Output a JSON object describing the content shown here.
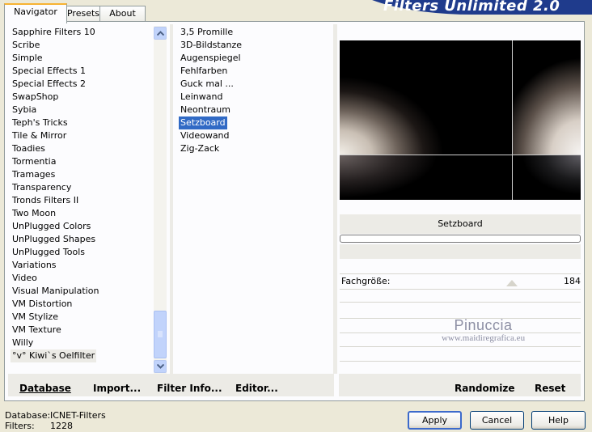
{
  "app_title": "Filters Unlimited 2.0",
  "tabs": [
    {
      "label": "Navigator",
      "active": true
    },
    {
      "label": "Presets",
      "active": false
    },
    {
      "label": "About",
      "active": false
    }
  ],
  "categories": [
    "Sapphire Filters 10",
    "Scribe",
    "Simple",
    "Special Effects 1",
    "Special Effects 2",
    "SwapShop",
    "Sybia",
    "Teph's Tricks",
    "Tile & Mirror",
    "Toadies",
    "Tormentia",
    "Tramages",
    "Transparency",
    "Tronds Filters II",
    "Two Moon",
    "UnPlugged Colors",
    "UnPlugged Shapes",
    "UnPlugged Tools",
    "Variations",
    "Video",
    "Visual Manipulation",
    "VM Distortion",
    "VM Stylize",
    "VM Texture",
    "Willy",
    "°v° Kiwi`s Oelfilter"
  ],
  "selected_category": "°v° Kiwi`s Oelfilter",
  "filters": [
    "3,5 Promille",
    "3D-Bildstanze",
    "Augenspiegel",
    "Fehlfarben",
    "Guck mal ...",
    "Leinwand",
    "Neontraum",
    "Setzboard",
    "Videowand",
    "Zig-Zack"
  ],
  "selected_filter": "Setzboard",
  "preview": {
    "filter_name": "Setzboard"
  },
  "parameters": [
    {
      "label": "Fachgröße:",
      "value": "184"
    }
  ],
  "watermark": {
    "name": "Pinuccia",
    "url": "www.maidiregrafica.eu"
  },
  "actions": {
    "database": "Database",
    "import": "Import...",
    "filter_info": "Filter Info...",
    "editor": "Editor...",
    "randomize": "Randomize",
    "reset": "Reset"
  },
  "status": {
    "database_label": "Database:",
    "database_value": "ICNET-Filters",
    "filters_label": "Filters:",
    "filters_value": "1228"
  },
  "buttons": {
    "apply": "Apply",
    "cancel": "Cancel",
    "help": "Help"
  },
  "colors": {
    "selection": "#316ac5",
    "banner": "#1f3b8c",
    "background": "#ece9d8"
  }
}
